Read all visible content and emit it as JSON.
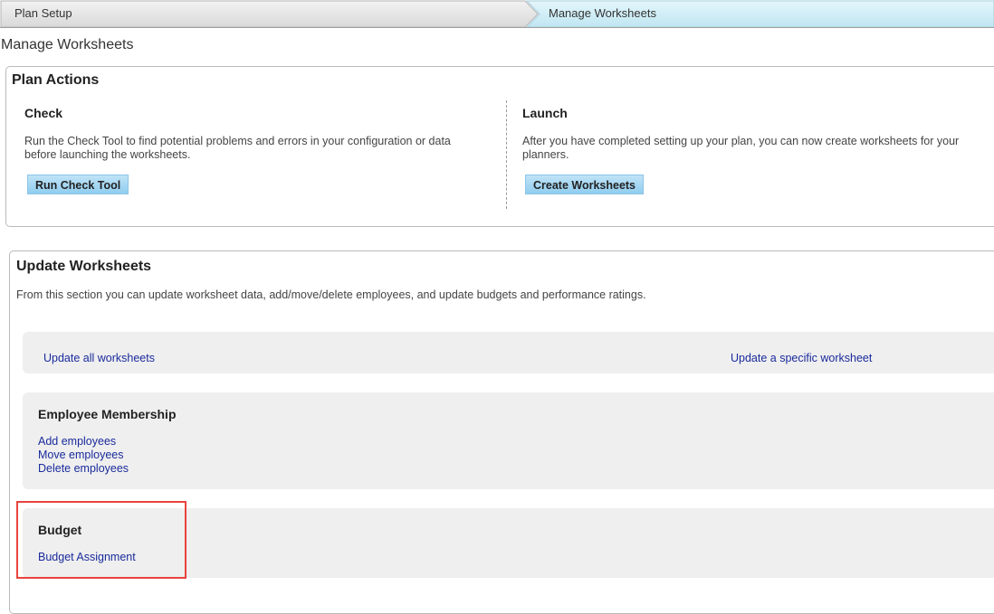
{
  "breadcrumb": {
    "step1": "Plan Setup",
    "step2": "Manage Worksheets"
  },
  "page_title": "Manage Worksheets",
  "plan_actions": {
    "title": "Plan Actions",
    "check": {
      "heading": "Check",
      "description_line1": "Run the Check Tool to find potential problems and errors in your configuration or data",
      "description_line2": "before launching the worksheets.",
      "button": "Run Check Tool"
    },
    "launch": {
      "heading": "Launch",
      "description_line1": "After you have completed setting up your plan, you can now create worksheets for your",
      "description_line2": "planners.",
      "button": "Create Worksheets"
    }
  },
  "update_worksheets": {
    "title": "Update Worksheets",
    "description": "From this section you can update worksheet data, add/move/delete employees, and update budgets and performance ratings.",
    "update_all": "Update all worksheets",
    "update_specific": "Update a specific worksheet",
    "employee_membership": {
      "heading": "Employee Membership",
      "links": [
        "Add employees",
        "Move employees",
        "Delete employees"
      ]
    },
    "budget": {
      "heading": "Budget",
      "link": "Budget Assignment"
    }
  },
  "colors": {
    "link": "#1a2b9c",
    "button_bg": "#a6d6f2",
    "highlight": "#e8433d",
    "active_step": "#c5eaf4"
  }
}
